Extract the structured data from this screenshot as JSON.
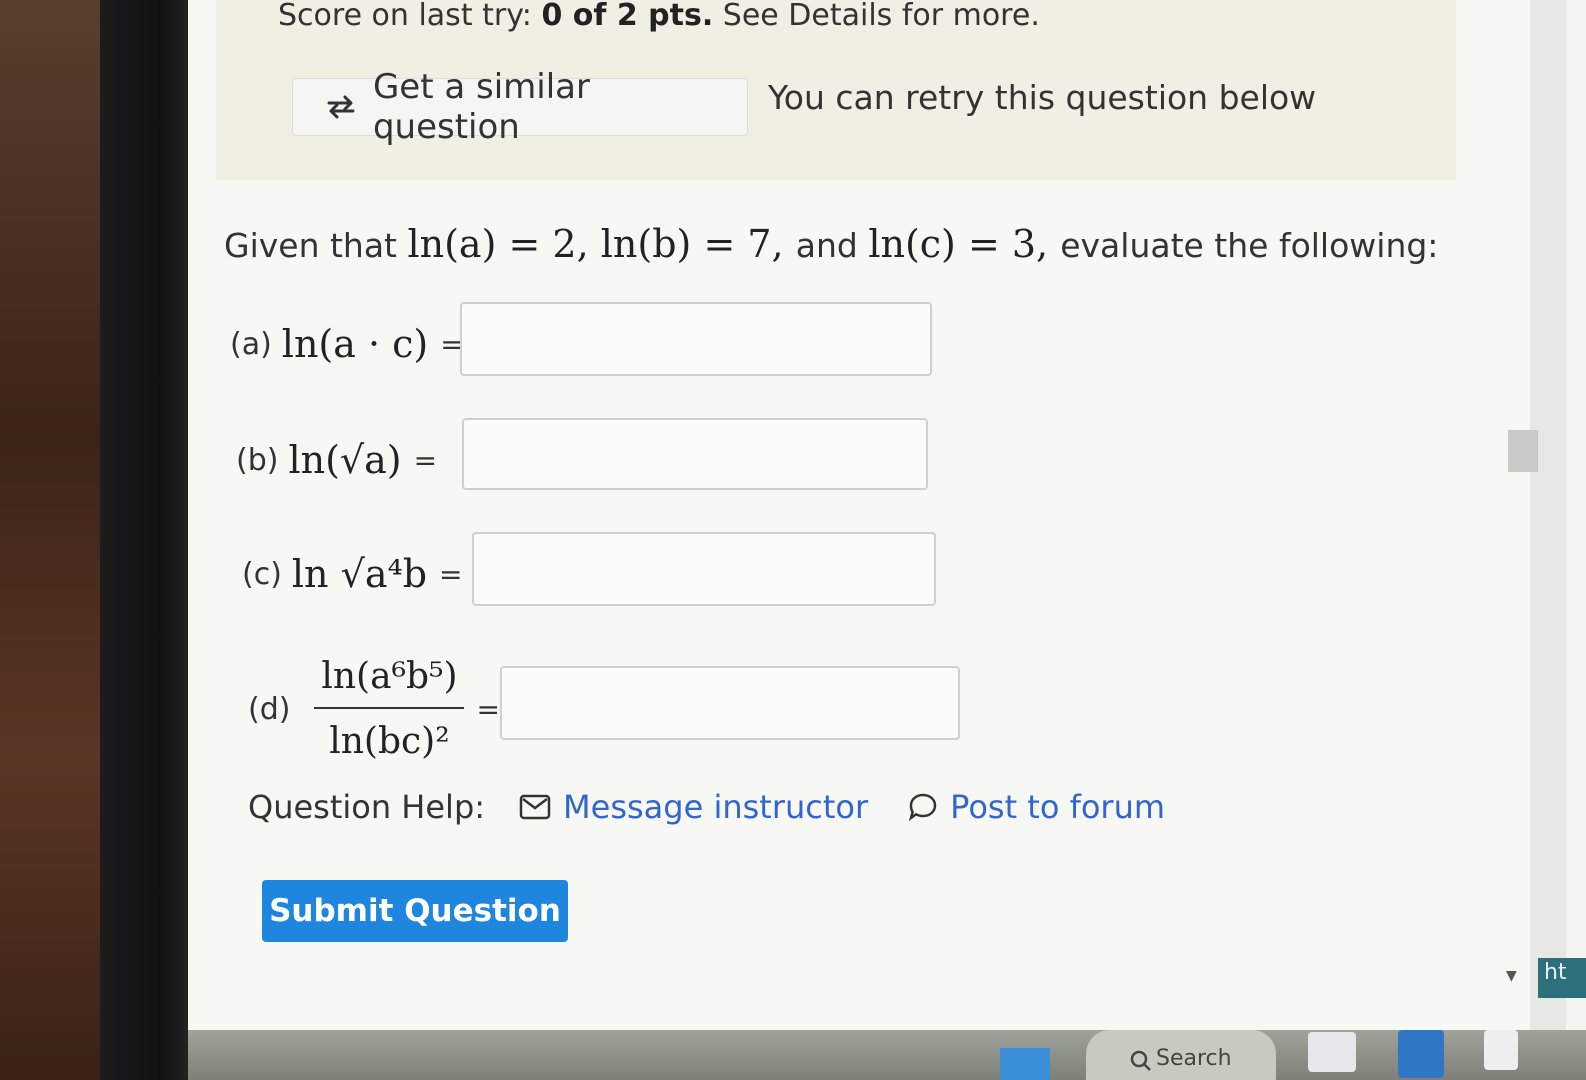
{
  "notice": {
    "score_prefix": "Score on last try: ",
    "score_value": "0 of 2 pts.",
    "score_suffix": " See Details for more.",
    "similar_button": "Get a similar question",
    "retry_text": "You can retry this question below"
  },
  "question": {
    "prompt_prefix": "Given that ",
    "prompt_a": "ln(a) = 2",
    "prompt_b": "ln(b) = 7",
    "prompt_and": "and",
    "prompt_c": "ln(c) = 3",
    "prompt_suffix": "evaluate the following:",
    "parts": [
      {
        "label": "(a)",
        "expression": "ln(a · c)",
        "answer": ""
      },
      {
        "label": "(b)",
        "expression": "ln(√a)",
        "answer": ""
      },
      {
        "label": "(c)",
        "expression": "ln √a⁴b",
        "answer": ""
      },
      {
        "label": "(d)",
        "numerator": "ln(a⁶b⁵)",
        "denominator": "ln(bc)²",
        "answer": ""
      }
    ],
    "equals": "="
  },
  "help": {
    "label": "Question Help:",
    "message_link": "Message instructor",
    "forum_link": "Post to forum"
  },
  "submit_label": "Submit Question",
  "taskbar": {
    "search_label": "Search",
    "edge_text": "ht"
  },
  "colors": {
    "link": "#3366cc",
    "submit": "#1f86e0",
    "notice_bg": "#efefe3"
  }
}
